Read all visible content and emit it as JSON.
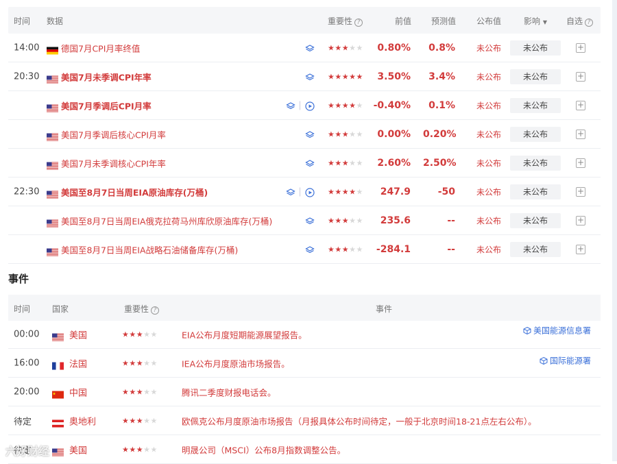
{
  "headers": {
    "time": "时间",
    "data": "数据",
    "importance": "重要性",
    "prev": "前值",
    "forecast": "预测值",
    "published": "公布值",
    "impact": "影响",
    "watch": "自选"
  },
  "rows": [
    {
      "time": "14:00",
      "country": "de",
      "name": "德国7月CPI月率终值",
      "bold": false,
      "video": false,
      "stars": 3,
      "prev": "0.80%",
      "forecast": "0.8%",
      "published": "未公布",
      "impact": "未公布"
    },
    {
      "time": "20:30",
      "country": "us",
      "name": "美国7月未季调CPI年率",
      "bold": true,
      "video": false,
      "stars": 5,
      "prev": "3.50%",
      "forecast": "3.4%",
      "published": "未公布",
      "impact": "未公布"
    },
    {
      "time": "",
      "country": "us",
      "name": "美国7月季调后CPI月率",
      "bold": true,
      "video": true,
      "stars": 4,
      "prev": "-0.40%",
      "forecast": "0.1%",
      "published": "未公布",
      "impact": "未公布"
    },
    {
      "time": "",
      "country": "us",
      "name": "美国7月季调后核心CPI月率",
      "bold": false,
      "video": false,
      "stars": 3,
      "prev": "0.00%",
      "forecast": "0.20%",
      "published": "未公布",
      "impact": "未公布"
    },
    {
      "time": "",
      "country": "us",
      "name": "美国7月未季调核心CPI年率",
      "bold": false,
      "video": false,
      "stars": 3,
      "prev": "2.60%",
      "forecast": "2.50%",
      "published": "未公布",
      "impact": "未公布"
    },
    {
      "time": "22:30",
      "country": "us",
      "name": "美国至8月7日当周EIA原油库存(万桶)",
      "bold": true,
      "video": true,
      "stars": 4,
      "prev": "247.9",
      "forecast": "-50",
      "published": "未公布",
      "impact": "未公布"
    },
    {
      "time": "",
      "country": "us",
      "name": "美国至8月7日当周EIA俄克拉荷马州库欣原油库存(万桶)",
      "bold": false,
      "video": false,
      "stars": 3,
      "prev": "235.6",
      "forecast": "--",
      "published": "未公布",
      "impact": "未公布"
    },
    {
      "time": "",
      "country": "us",
      "name": "美国至8月7日当周EIA战略石油储备库存(万桶)",
      "bold": false,
      "video": false,
      "stars": 3,
      "prev": "-284.1",
      "forecast": "--",
      "published": "未公布",
      "impact": "未公布"
    }
  ],
  "events_title": "事件",
  "event_headers": {
    "time": "时间",
    "country": "国家",
    "importance": "重要性",
    "event": "事件"
  },
  "events": [
    {
      "time": "00:00",
      "country_code": "us",
      "country": "美国",
      "stars": 3,
      "text": "EIA公布月度短期能源展望报告。",
      "source": "美国能源信息署"
    },
    {
      "time": "16:00",
      "country_code": "fr",
      "country": "法国",
      "stars": 3,
      "text": "IEA公布月度原油市场报告。",
      "source": "国际能源署"
    },
    {
      "time": "20:00",
      "country_code": "cn",
      "country": "中国",
      "stars": 3,
      "text": "腾讯二季度财报电话会。",
      "source": ""
    },
    {
      "time": "待定",
      "country_code": "at",
      "country": "奥地利",
      "stars": 3,
      "text": "欧佩克公布月度原油市场报告（月报具体公布时间待定，一般于北京时间18-21点左右公布）。",
      "source": ""
    },
    {
      "time": "待定",
      "country_code": "us",
      "country": "美国",
      "stars": 3,
      "text": "明晟公司（MSCI）公布8月指数调整公告。",
      "source": ""
    }
  ],
  "watermark": "六好财经",
  "colors": {
    "accent_red": "#d23b3b",
    "link_blue": "#3a6fd8",
    "header_bg": "#f5f6f8"
  }
}
